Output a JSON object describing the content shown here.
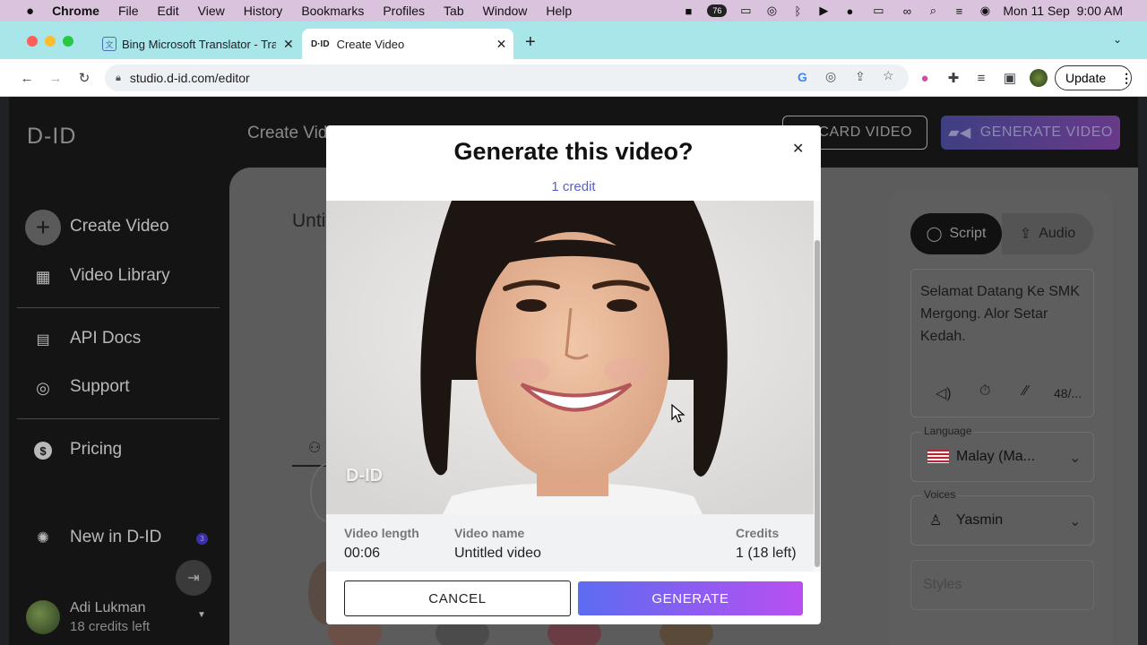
{
  "menubar": {
    "app": "Chrome",
    "items": [
      "File",
      "Edit",
      "View",
      "History",
      "Bookmarks",
      "Profiles",
      "Tab",
      "Window",
      "Help"
    ],
    "battery_badge": "76",
    "datetime": "Mon 11 Sep  9:00 AM"
  },
  "browser": {
    "tabs": [
      {
        "title": "Bing Microsoft Translator - Tra",
        "favicon": "translator-icon"
      },
      {
        "title": "Create Video",
        "favicon": "d-id-icon"
      }
    ],
    "url": "studio.d-id.com/editor",
    "update_label": "Update"
  },
  "app": {
    "logo": "D-ID",
    "header_title": "Create Video",
    "discard_label": "DISCARD VIDEO",
    "generate_label": "GENERATE VIDEO",
    "editor_title": "Untitled video",
    "sidebar": {
      "items": [
        {
          "label": "Create Video",
          "icon": "plus-circle-icon"
        },
        {
          "label": "Video Library",
          "icon": "grid-icon"
        },
        {
          "label": "API Docs",
          "icon": "document-icon"
        },
        {
          "label": "Support",
          "icon": "lifebuoy-icon"
        },
        {
          "label": "Pricing",
          "icon": "dollar-icon"
        },
        {
          "label": "New in D-ID",
          "icon": "party-icon",
          "badge": "3"
        }
      ],
      "user": {
        "name": "Adi Lukman",
        "credits": "18 credits left"
      }
    },
    "right_panel": {
      "tabs": [
        "Script",
        "Audio"
      ],
      "script_text": "Selamat Datang Ke SMK Mergong. Alor Setar Kedah.",
      "char_count": "48/...",
      "language_label": "Language",
      "language_value": "Malay (Ma...",
      "voices_label": "Voices",
      "voice_value": "Yasmin",
      "styles_placeholder": "Styles"
    }
  },
  "modal": {
    "title": "Generate this video?",
    "credit": "1 credit",
    "watermark": "D-ID",
    "video_length_label": "Video length",
    "video_length": "00:06",
    "video_name_label": "Video name",
    "video_name": "Untitled video",
    "credits_label": "Credits",
    "credits_value": "1 (18 left)",
    "cancel_label": "CANCEL",
    "generate_label": "GENERATE"
  },
  "colors": {
    "accent_start": "#5c6cf1",
    "accent_end": "#b94ff2",
    "credit_text": "#5b5fc7"
  }
}
